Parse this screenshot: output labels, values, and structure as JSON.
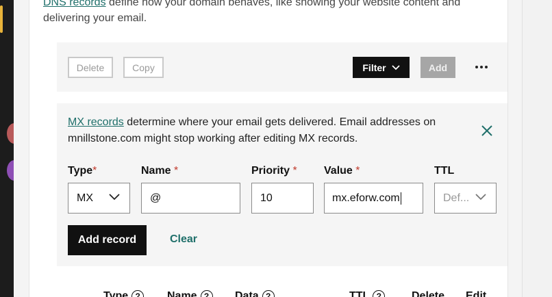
{
  "intro": {
    "link": "DNS records",
    "text": " define how your domain behaves, like showing your website content and delivering your email."
  },
  "toolbar": {
    "delete_label": "Delete",
    "copy_label": "Copy",
    "filter_label": "Filter",
    "add_label": "Add"
  },
  "notice": {
    "link": "MX records",
    "text": " determine where your email gets delivered. Email addresses on mnillstone.com might stop working after editing MX records."
  },
  "form": {
    "type_label": "Type",
    "name_label": "Name",
    "priority_label": "Priority",
    "value_label": "Value",
    "ttl_label": "TTL",
    "required_mark": "*",
    "type_value": "MX",
    "name_value": "@",
    "priority_value": "10",
    "value_value": "mx.eforw.com",
    "ttl_placeholder": "Def...",
    "add_record_label": "Add record",
    "clear_label": "Clear"
  },
  "table": {
    "columns": [
      "Type",
      "Name",
      "Data",
      "TTL",
      "Delete",
      "Edit"
    ],
    "help_glyph": "?"
  },
  "colors": {
    "accent_link": "#1f6f6a",
    "primary_button": "#111111",
    "disabled_button": "#a6a6a6",
    "required": "#c0392b"
  }
}
